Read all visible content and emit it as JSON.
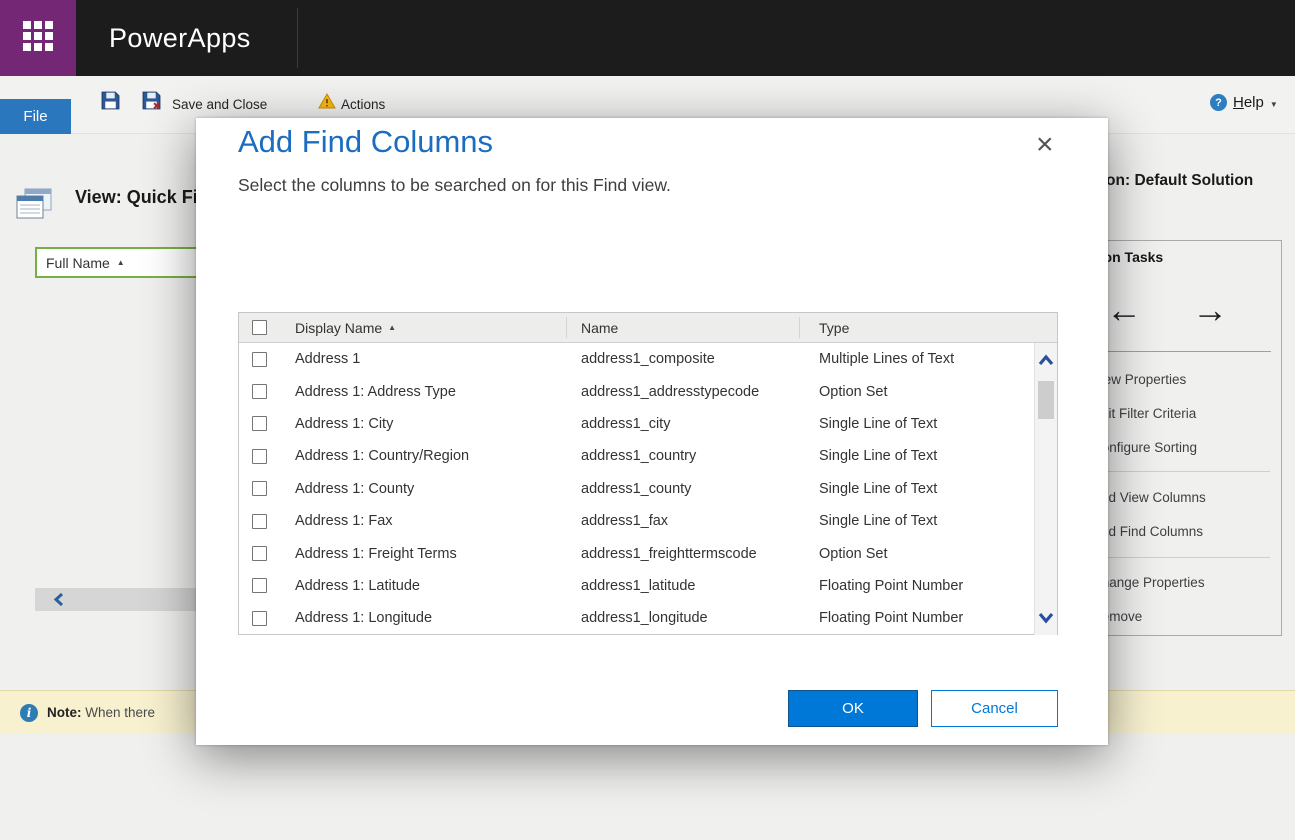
{
  "topbar": {
    "app_name": "PowerApps"
  },
  "ribbon": {
    "file_label": "File",
    "save_and_close_label": "Save and Close",
    "actions_label": "Actions",
    "help": {
      "accesskey": "H",
      "rest": "elp"
    }
  },
  "page": {
    "view_title": "View: Quick Find Active Contacts",
    "solution_label": "Solution: Default Solution",
    "selected_column_header": "Full Name",
    "common_tasks": {
      "title": "Common Tasks",
      "links": [
        "View Properties",
        "Edit Filter Criteria",
        "Configure Sorting",
        "Add View Columns",
        "Add Find Columns",
        "Change Properties",
        "Remove"
      ]
    },
    "note": {
      "label": "Note:",
      "text": "When there"
    }
  },
  "dialog": {
    "title": "Add Find Columns",
    "subtitle": "Select the columns to be searched on for this Find view.",
    "table": {
      "headers": {
        "display": "Display Name",
        "name": "Name",
        "type": "Type"
      },
      "rows": [
        {
          "display": "Address 1",
          "name": "address1_composite",
          "type": "Multiple Lines of Text"
        },
        {
          "display": "Address 1: Address Type",
          "name": "address1_addresstypecode",
          "type": "Option Set"
        },
        {
          "display": "Address 1: City",
          "name": "address1_city",
          "type": "Single Line of Text"
        },
        {
          "display": "Address 1: Country/Region",
          "name": "address1_country",
          "type": "Single Line of Text"
        },
        {
          "display": "Address 1: County",
          "name": "address1_county",
          "type": "Single Line of Text"
        },
        {
          "display": "Address 1: Fax",
          "name": "address1_fax",
          "type": "Single Line of Text"
        },
        {
          "display": "Address 1: Freight Terms",
          "name": "address1_freighttermscode",
          "type": "Option Set"
        },
        {
          "display": "Address 1: Latitude",
          "name": "address1_latitude",
          "type": "Floating Point Number"
        },
        {
          "display": "Address 1: Longitude",
          "name": "address1_longitude",
          "type": "Floating Point Number"
        }
      ]
    },
    "ok_label": "OK",
    "cancel_label": "Cancel"
  },
  "icons": {
    "sort_asc": "▲",
    "close": "×",
    "caret_down": "▼",
    "arrow_left": "←",
    "arrow_right": "→",
    "info": "i",
    "help": "?"
  },
  "colors": {
    "brand_purple": "#742774",
    "primary_blue": "#0078d7",
    "dialog_title_blue": "#1a6dc0",
    "file_tab_blue": "#2a77bd",
    "selected_green": "#76b041",
    "note_bg": "#f8f1d0"
  }
}
